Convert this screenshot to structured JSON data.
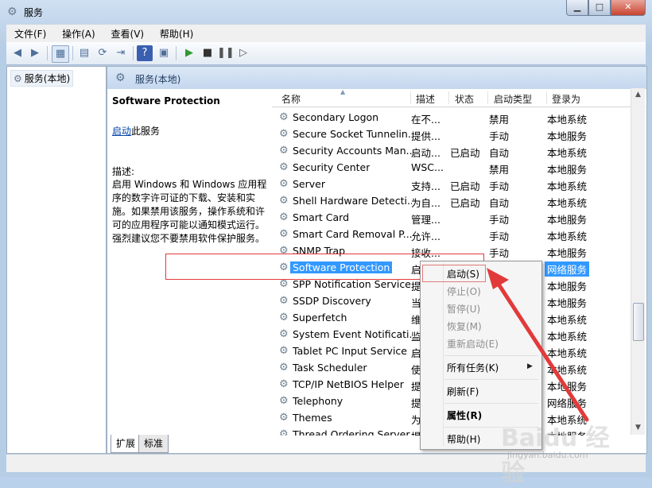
{
  "window": {
    "title": "服务",
    "buttons": [
      "▁",
      "□",
      "✕"
    ]
  },
  "menu": [
    "文件(F)",
    "操作(A)",
    "查看(V)",
    "帮助(H)"
  ],
  "tree": {
    "root_label": "服务(本地)"
  },
  "pane_header": "服务(本地)",
  "description": {
    "service_title": "Software Protection",
    "start_link": "启动",
    "start_suffix": "此服务",
    "label": "描述:",
    "text": "启用 Windows 和 Windows 应用程序的数字许可证的下载、安装和实施。如果禁用该服务，操作系统和许可的应用程序可能以通知模式运行。强烈建议您不要禁用软件保护服务。"
  },
  "columns": {
    "name": "名称",
    "desc": "描述",
    "status": "状态",
    "startup": "启动类型",
    "logon": "登录为"
  },
  "services": [
    {
      "name": "Secondary Logon",
      "desc": "在不...",
      "status": "",
      "startup": "禁用",
      "logon": "本地系统"
    },
    {
      "name": "Secure Socket Tunnelin...",
      "desc": "提供...",
      "status": "",
      "startup": "手动",
      "logon": "本地服务"
    },
    {
      "name": "Security Accounts Man...",
      "desc": "启动...",
      "status": "已启动",
      "startup": "自动",
      "logon": "本地系统"
    },
    {
      "name": "Security Center",
      "desc": "WSC...",
      "status": "",
      "startup": "禁用",
      "logon": "本地服务"
    },
    {
      "name": "Server",
      "desc": "支持...",
      "status": "已启动",
      "startup": "手动",
      "logon": "本地系统"
    },
    {
      "name": "Shell Hardware Detecti...",
      "desc": "为自...",
      "status": "已启动",
      "startup": "自动",
      "logon": "本地系统"
    },
    {
      "name": "Smart Card",
      "desc": "管理...",
      "status": "",
      "startup": "手动",
      "logon": "本地服务"
    },
    {
      "name": "Smart Card Removal P...",
      "desc": "允许...",
      "status": "",
      "startup": "手动",
      "logon": "本地系统"
    },
    {
      "name": "SNMP Trap",
      "desc": "接收...",
      "status": "",
      "startup": "手动",
      "logon": "本地服务"
    },
    {
      "name": "Software Protection",
      "desc": "启",
      "status": "",
      "startup": "",
      "logon": "网络服务"
    },
    {
      "name": "SPP Notification Service",
      "desc": "提",
      "status": "",
      "startup": "",
      "logon": "本地服务"
    },
    {
      "name": "SSDP Discovery",
      "desc": "当",
      "status": "",
      "startup": "",
      "logon": "本地服务"
    },
    {
      "name": "Superfetch",
      "desc": "维",
      "status": "",
      "startup": "",
      "logon": "本地系统"
    },
    {
      "name": "System Event Notificati...",
      "desc": "监",
      "status": "",
      "startup": "",
      "logon": "本地系统"
    },
    {
      "name": "Tablet PC Input Service",
      "desc": "启",
      "status": "",
      "startup": "",
      "logon": "本地系统"
    },
    {
      "name": "Task Scheduler",
      "desc": "使",
      "status": "",
      "startup": "",
      "logon": "本地系统"
    },
    {
      "name": "TCP/IP NetBIOS Helper",
      "desc": "提",
      "status": "",
      "startup": "",
      "logon": "本地服务"
    },
    {
      "name": "Telephony",
      "desc": "提",
      "status": "",
      "startup": "",
      "logon": "网络服务"
    },
    {
      "name": "Themes",
      "desc": "为",
      "status": "",
      "startup": "",
      "logon": "本地系统"
    },
    {
      "name": "Thread Ordering Server",
      "desc": "提",
      "status": "",
      "startup": "",
      "logon": "本地服务"
    }
  ],
  "selected_index": 9,
  "context_menu": {
    "start": "启动(S)",
    "stop": "停止(O)",
    "pause": "暂停(U)",
    "resume": "恢复(M)",
    "restart": "重新启动(E)",
    "all_tasks": "所有任务(K)",
    "refresh": "刷新(F)",
    "properties": "属性(R)",
    "help": "帮助(H)"
  },
  "tabs": [
    "扩展",
    "标准"
  ],
  "watermark": {
    "brand": "Baidu 经验",
    "url": "jingyan.baidu.com"
  },
  "colors": {
    "selection": "#3399ff",
    "annotation": "#e23a3a",
    "link": "#0645ad"
  }
}
